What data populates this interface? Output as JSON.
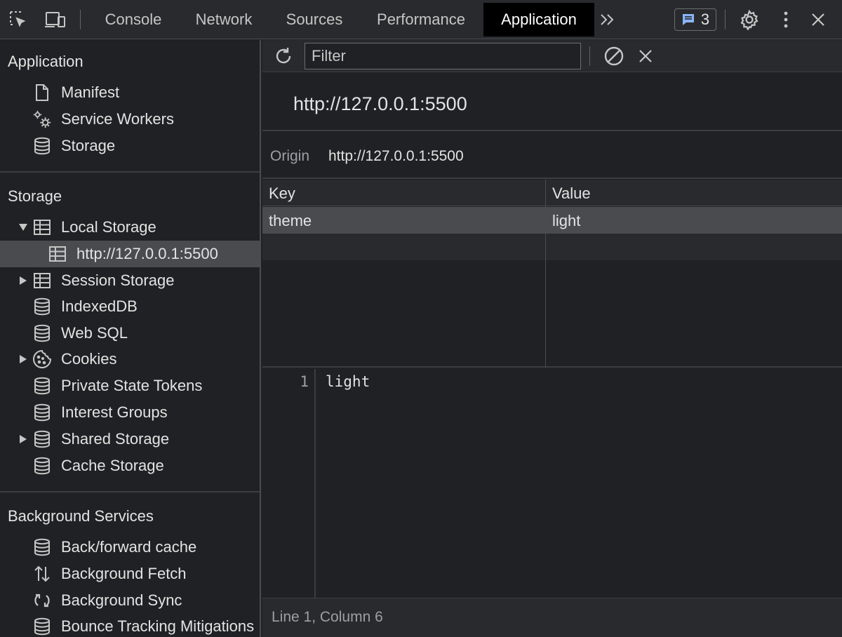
{
  "tabs": [
    {
      "label": "Console"
    },
    {
      "label": "Network"
    },
    {
      "label": "Sources"
    },
    {
      "label": "Performance"
    },
    {
      "label": "Application"
    }
  ],
  "active_tab": "Application",
  "issues_count": "3",
  "sidebar": {
    "application": {
      "title": "Application",
      "items": [
        {
          "label": "Manifest",
          "icon": "document-icon"
        },
        {
          "label": "Service Workers",
          "icon": "gears-icon"
        },
        {
          "label": "Storage",
          "icon": "database-icon"
        }
      ]
    },
    "storage": {
      "title": "Storage",
      "items": [
        {
          "label": "Local Storage",
          "icon": "table-icon",
          "expanded": true
        },
        {
          "label": "http://127.0.0.1:5500",
          "icon": "table-icon",
          "selected": true
        },
        {
          "label": "Session Storage",
          "icon": "table-icon",
          "expanded": false
        },
        {
          "label": "IndexedDB",
          "icon": "database-icon"
        },
        {
          "label": "Web SQL",
          "icon": "database-icon"
        },
        {
          "label": "Cookies",
          "icon": "cookie-icon",
          "expanded": false
        },
        {
          "label": "Private State Tokens",
          "icon": "database-icon"
        },
        {
          "label": "Interest Groups",
          "icon": "database-icon"
        },
        {
          "label": "Shared Storage",
          "icon": "database-icon",
          "expanded": false
        },
        {
          "label": "Cache Storage",
          "icon": "database-icon"
        }
      ]
    },
    "background": {
      "title": "Background Services",
      "items": [
        {
          "label": "Back/forward cache",
          "icon": "database-icon"
        },
        {
          "label": "Background Fetch",
          "icon": "up-down-arrows-icon"
        },
        {
          "label": "Background Sync",
          "icon": "sync-icon"
        },
        {
          "label": "Bounce Tracking Mitigations",
          "icon": "database-icon"
        }
      ]
    }
  },
  "toolbar": {
    "filter_placeholder": "Filter"
  },
  "main": {
    "origin_heading": "http://127.0.0.1:5500",
    "origin_label": "Origin",
    "origin_value": "http://127.0.0.1:5500",
    "columns": [
      "Key",
      "Value"
    ],
    "rows": [
      {
        "key": "theme",
        "value": "light"
      }
    ],
    "editor": {
      "line_number": "1",
      "text": "light"
    },
    "status": "Line 1, Column 6"
  },
  "colors": {
    "background": "#202124",
    "toolbar": "#292a2d",
    "selected_row": "#4a4b4f",
    "active_tab": "#000000",
    "issues_badge_icon": "#8ab4f8"
  }
}
